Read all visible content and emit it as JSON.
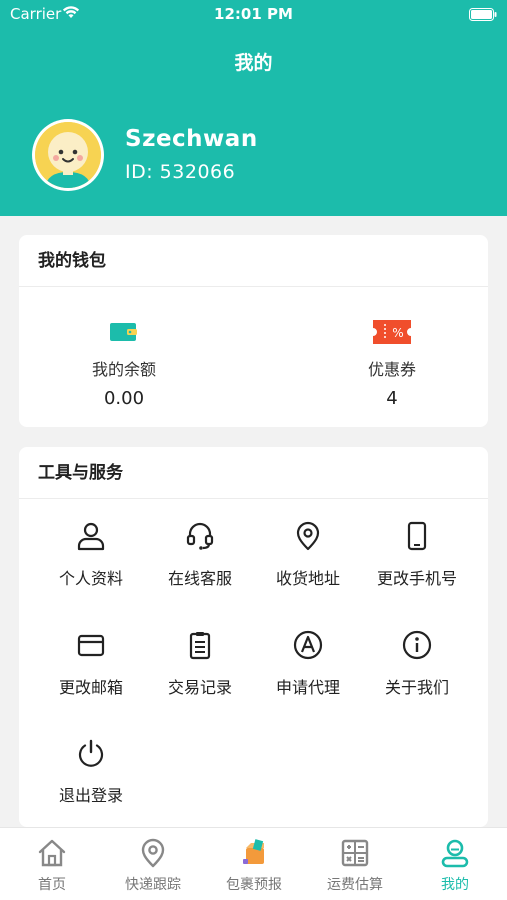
{
  "status_bar": {
    "carrier": "Carrier",
    "time": "12:01 PM"
  },
  "header": {
    "title": "我的"
  },
  "profile": {
    "name": "Szechwan",
    "id_text": "ID: 532066"
  },
  "wallet": {
    "title": "我的钱包",
    "items": [
      {
        "label": "我的余额",
        "value": "0.00",
        "icon": "wallet-icon"
      },
      {
        "label": "优惠券",
        "value": "4",
        "icon": "coupon-icon"
      }
    ]
  },
  "tools": {
    "title": "工具与服务",
    "items": [
      {
        "label": "个人资料",
        "icon": "person-icon"
      },
      {
        "label": "在线客服",
        "icon": "headset-icon"
      },
      {
        "label": "收货地址",
        "icon": "location-pin-icon"
      },
      {
        "label": "更改手机号",
        "icon": "phone-icon"
      },
      {
        "label": "更改邮箱",
        "icon": "mail-icon"
      },
      {
        "label": "交易记录",
        "icon": "clipboard-icon"
      },
      {
        "label": "申请代理",
        "icon": "letter-a-circle-icon"
      },
      {
        "label": "关于我们",
        "icon": "info-icon"
      },
      {
        "label": "退出登录",
        "icon": "power-icon"
      }
    ]
  },
  "tabbar": {
    "items": [
      {
        "label": "首页",
        "icon": "home-icon"
      },
      {
        "label": "快递跟踪",
        "icon": "location-pin-icon"
      },
      {
        "label": "包裹预报",
        "icon": "package-icon"
      },
      {
        "label": "运费估算",
        "icon": "calculator-icon"
      },
      {
        "label": "我的",
        "icon": "profile-icon"
      }
    ],
    "active_index": 4
  },
  "colors": {
    "primary": "#1cbcab",
    "coupon_red": "#f04e2c"
  }
}
